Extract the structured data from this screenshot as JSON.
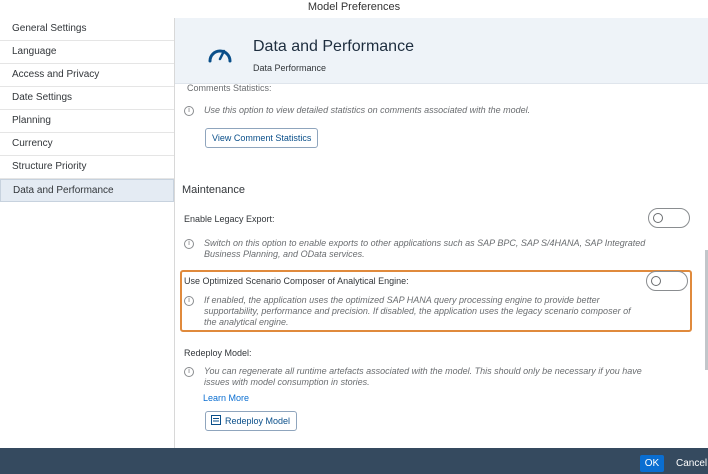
{
  "window": {
    "title": "Model Preferences"
  },
  "sidebar": {
    "items": [
      {
        "label": "General Settings"
      },
      {
        "label": "Language"
      },
      {
        "label": "Access and Privacy"
      },
      {
        "label": "Date Settings"
      },
      {
        "label": "Planning"
      },
      {
        "label": "Currency"
      },
      {
        "label": "Structure Priority"
      },
      {
        "label": "Data and Performance",
        "active": true
      }
    ]
  },
  "header": {
    "icon": "gauge-icon",
    "title": "Data and Performance",
    "subtitle": "Data Performance"
  },
  "comments": {
    "label": "Comments Statistics:",
    "info": "Use this option to view detailed statistics on comments associated with the model.",
    "button": "View Comment Statistics"
  },
  "maintenance": {
    "title": "Maintenance",
    "legacy_export": {
      "label": "Enable Legacy Export:",
      "enabled": false,
      "info_line1": "Switch on this option to enable exports to other applications such as SAP BPC, SAP S/4HANA, SAP Integrated",
      "info_line2": "Business Planning, and OData services."
    },
    "optimized_composer": {
      "label": "Use Optimized Scenario Composer of Analytical Engine:",
      "enabled": false,
      "info_line1": "If enabled, the application uses the optimized SAP HANA query processing engine to provide better",
      "info_line2": "supportability, performance and precision. If disabled, the application uses the legacy scenario composer of",
      "info_line3": "the analytical engine."
    },
    "redeploy": {
      "label": "Redeploy Model:",
      "info_line1": "You can regenerate all runtime artefacts associated with the model. This should only be necessary if you have",
      "info_line2": "issues with model consumption in stories.",
      "learn_more": "Learn More",
      "button": "Redeploy Model"
    }
  },
  "footer": {
    "ok": "OK",
    "cancel": "Cancel"
  },
  "colors": {
    "accent": "#0a6ed1",
    "footer_bg": "#354a5f",
    "highlight": "#e08a3c"
  }
}
